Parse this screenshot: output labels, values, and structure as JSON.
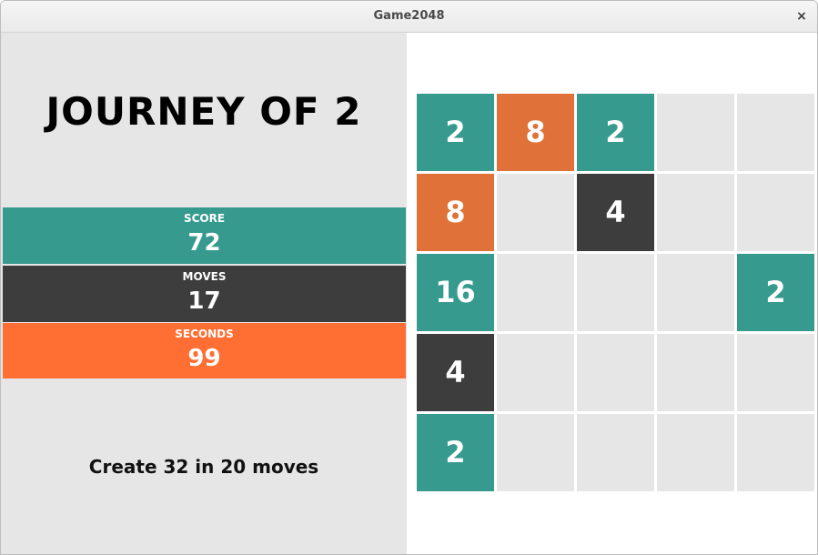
{
  "window": {
    "title": "Game2048",
    "close_label": "×"
  },
  "game": {
    "headline": "JOURNEY OF 2",
    "stats": {
      "score": {
        "label": "SCORE",
        "value": "72"
      },
      "moves": {
        "label": "MOVES",
        "value": "17"
      },
      "seconds": {
        "label": "SECONDS",
        "value": "99"
      }
    },
    "goal": "Create 32 in 20 moves"
  },
  "board": {
    "rows": [
      [
        "2",
        "8",
        "2",
        "",
        ""
      ],
      [
        "8",
        "",
        "4",
        "",
        ""
      ],
      [
        "16",
        "",
        "",
        "",
        "2"
      ],
      [
        "4",
        "",
        "",
        "",
        ""
      ],
      [
        "2",
        "",
        "",
        "",
        ""
      ]
    ]
  },
  "colors": {
    "teal": "#379a8f",
    "dark": "#3d3d3d",
    "orange": "#e07138",
    "seconds_orange": "#ff6e33",
    "empty": "#e6e6e6"
  }
}
